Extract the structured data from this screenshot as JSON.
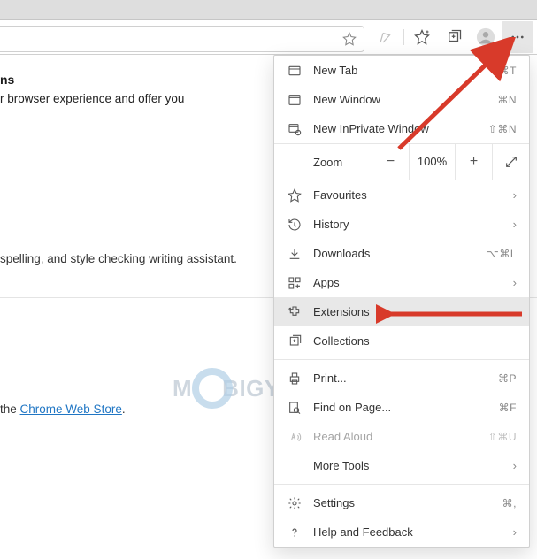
{
  "toolbar": {
    "icons": {
      "fav_outline": "star-outline-icon",
      "reader": "reader-icon",
      "fav_plus": "star-plus-icon",
      "collections": "collections-icon",
      "profile": "profile-icon",
      "more": "more-icon"
    }
  },
  "page": {
    "heading_suffix": "ns",
    "desc_fragment": "r browser experience and offer you",
    "grammar_fragment": "spelling, and style checking writing assistant.",
    "findmore_prefix": "the ",
    "findmore_link": "Chrome Web Store",
    "findmore_suffix": "."
  },
  "watermark": {
    "text_a": "M",
    "text_b": "BIGYAAN"
  },
  "menu": {
    "items": [
      {
        "label": "New Tab",
        "shortcut": "⌘T"
      },
      {
        "label": "New Window",
        "shortcut": "⌘N"
      },
      {
        "label": "New InPrivate Window",
        "shortcut": "⇧⌘N"
      }
    ],
    "zoom": {
      "label": "Zoom",
      "value": "100%"
    },
    "items2": [
      {
        "label": "Favourites",
        "chevron": true
      },
      {
        "label": "History",
        "chevron": true
      },
      {
        "label": "Downloads",
        "shortcut": "⌥⌘L"
      },
      {
        "label": "Apps",
        "chevron": true
      },
      {
        "label": "Extensions",
        "selected": true
      },
      {
        "label": "Collections"
      }
    ],
    "items3": [
      {
        "label": "Print...",
        "shortcut": "⌘P"
      },
      {
        "label": "Find on Page...",
        "shortcut": "⌘F"
      },
      {
        "label": "Read Aloud",
        "shortcut": "⇧⌘U",
        "disabled": true
      },
      {
        "label": "More Tools",
        "chevron": true
      }
    ],
    "items4": [
      {
        "label": "Settings",
        "shortcut": "⌘,"
      },
      {
        "label": "Help and Feedback",
        "chevron": true
      }
    ]
  }
}
